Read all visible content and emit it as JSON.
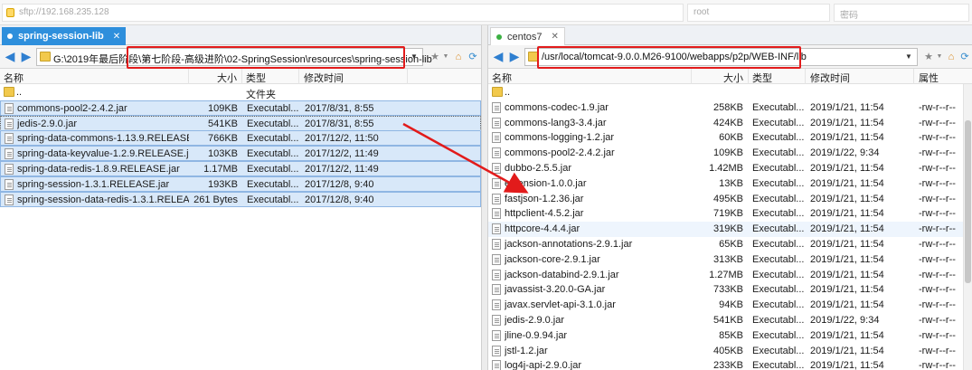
{
  "topbar": {
    "host_placeholder": "sftp://192.168.235.128",
    "user_placeholder": "root",
    "password_placeholder": "密码"
  },
  "left": {
    "tab_label": "spring-session-lib",
    "path": "G:\\2019年最后阶段\\第七阶段-高级进阶\\02-SpringSession\\resources\\spring-session-lib",
    "columns": {
      "name": "名称",
      "size": "大小",
      "type": "类型",
      "mtime": "修改时间"
    },
    "rows": [
      {
        "name": "..",
        "size": "",
        "type": "文件夹",
        "mtime": "",
        "kind": "dir",
        "state": ""
      },
      {
        "name": "commons-pool2-2.4.2.jar",
        "size": "109KB",
        "type": "Executabl...",
        "mtime": "2017/8/31, 8:55",
        "kind": "file",
        "state": "selected"
      },
      {
        "name": "jedis-2.9.0.jar",
        "size": "541KB",
        "type": "Executabl...",
        "mtime": "2017/8/31, 8:55",
        "kind": "file",
        "state": "focused"
      },
      {
        "name": "spring-data-commons-1.13.9.RELEASE.j...",
        "size": "766KB",
        "type": "Executabl...",
        "mtime": "2017/12/2, 11:50",
        "kind": "file",
        "state": "selected"
      },
      {
        "name": "spring-data-keyvalue-1.2.9.RELEASE.jar",
        "size": "103KB",
        "type": "Executabl...",
        "mtime": "2017/12/2, 11:49",
        "kind": "file",
        "state": "selected"
      },
      {
        "name": "spring-data-redis-1.8.9.RELEASE.jar",
        "size": "1.17MB",
        "type": "Executabl...",
        "mtime": "2017/12/2, 11:49",
        "kind": "file",
        "state": "selected"
      },
      {
        "name": "spring-session-1.3.1.RELEASE.jar",
        "size": "193KB",
        "type": "Executabl...",
        "mtime": "2017/12/8, 9:40",
        "kind": "file",
        "state": "selected"
      },
      {
        "name": "spring-session-data-redis-1.3.1.RELEAS...",
        "size": "261 Bytes",
        "type": "Executabl...",
        "mtime": "2017/12/8, 9:40",
        "kind": "file",
        "state": "selected"
      }
    ]
  },
  "right": {
    "tab_label": "centos7",
    "path": "/usr/local/tomcat-9.0.0.M26-9100/webapps/p2p/WEB-INF/lib",
    "columns": {
      "name": "名称",
      "size": "大小",
      "type": "类型",
      "mtime": "修改时间",
      "attr": "属性"
    },
    "rows": [
      {
        "name": "..",
        "size": "",
        "type": "",
        "mtime": "",
        "attr": "",
        "kind": "dir",
        "state": ""
      },
      {
        "name": "commons-codec-1.9.jar",
        "size": "258KB",
        "type": "Executabl...",
        "mtime": "2019/1/21, 11:54",
        "attr": "-rw-r--r--",
        "kind": "file",
        "state": ""
      },
      {
        "name": "commons-lang3-3.4.jar",
        "size": "424KB",
        "type": "Executabl...",
        "mtime": "2019/1/21, 11:54",
        "attr": "-rw-r--r--",
        "kind": "file",
        "state": ""
      },
      {
        "name": "commons-logging-1.2.jar",
        "size": "60KB",
        "type": "Executabl...",
        "mtime": "2019/1/21, 11:54",
        "attr": "-rw-r--r--",
        "kind": "file",
        "state": ""
      },
      {
        "name": "commons-pool2-2.4.2.jar",
        "size": "109KB",
        "type": "Executabl...",
        "mtime": "2019/1/22, 9:34",
        "attr": "-rw-r--r--",
        "kind": "file",
        "state": ""
      },
      {
        "name": "dubbo-2.5.5.jar",
        "size": "1.42MB",
        "type": "Executabl...",
        "mtime": "2019/1/21, 11:54",
        "attr": "-rw-r--r--",
        "kind": "file",
        "state": ""
      },
      {
        "name": "extension-1.0.0.jar",
        "size": "13KB",
        "type": "Executabl...",
        "mtime": "2019/1/21, 11:54",
        "attr": "-rw-r--r--",
        "kind": "file",
        "state": ""
      },
      {
        "name": "fastjson-1.2.36.jar",
        "size": "495KB",
        "type": "Executabl...",
        "mtime": "2019/1/21, 11:54",
        "attr": "-rw-r--r--",
        "kind": "file",
        "state": ""
      },
      {
        "name": "httpclient-4.5.2.jar",
        "size": "719KB",
        "type": "Executabl...",
        "mtime": "2019/1/21, 11:54",
        "attr": "-rw-r--r--",
        "kind": "file",
        "state": ""
      },
      {
        "name": "httpcore-4.4.4.jar",
        "size": "319KB",
        "type": "Executabl...",
        "mtime": "2019/1/21, 11:54",
        "attr": "-rw-r--r--",
        "kind": "file",
        "state": "hover"
      },
      {
        "name": "jackson-annotations-2.9.1.jar",
        "size": "65KB",
        "type": "Executabl...",
        "mtime": "2019/1/21, 11:54",
        "attr": "-rw-r--r--",
        "kind": "file",
        "state": ""
      },
      {
        "name": "jackson-core-2.9.1.jar",
        "size": "313KB",
        "type": "Executabl...",
        "mtime": "2019/1/21, 11:54",
        "attr": "-rw-r--r--",
        "kind": "file",
        "state": ""
      },
      {
        "name": "jackson-databind-2.9.1.jar",
        "size": "1.27MB",
        "type": "Executabl...",
        "mtime": "2019/1/21, 11:54",
        "attr": "-rw-r--r--",
        "kind": "file",
        "state": ""
      },
      {
        "name": "javassist-3.20.0-GA.jar",
        "size": "733KB",
        "type": "Executabl...",
        "mtime": "2019/1/21, 11:54",
        "attr": "-rw-r--r--",
        "kind": "file",
        "state": ""
      },
      {
        "name": "javax.servlet-api-3.1.0.jar",
        "size": "94KB",
        "type": "Executabl...",
        "mtime": "2019/1/21, 11:54",
        "attr": "-rw-r--r--",
        "kind": "file",
        "state": ""
      },
      {
        "name": "jedis-2.9.0.jar",
        "size": "541KB",
        "type": "Executabl...",
        "mtime": "2019/1/22, 9:34",
        "attr": "-rw-r--r--",
        "kind": "file",
        "state": ""
      },
      {
        "name": "jline-0.9.94.jar",
        "size": "85KB",
        "type": "Executabl...",
        "mtime": "2019/1/21, 11:54",
        "attr": "-rw-r--r--",
        "kind": "file",
        "state": ""
      },
      {
        "name": "jstl-1.2.jar",
        "size": "405KB",
        "type": "Executabl...",
        "mtime": "2019/1/21, 11:54",
        "attr": "-rw-r--r--",
        "kind": "file",
        "state": ""
      },
      {
        "name": "log4j-api-2.9.0.jar",
        "size": "233KB",
        "type": "Executabl...",
        "mtime": "2019/1/21, 11:54",
        "attr": "-rw-r--r--",
        "kind": "file",
        "state": ""
      }
    ]
  },
  "colors": {
    "accent": "#2e8fdc",
    "annotation": "#e21b1b",
    "selection": "#d8e8f9",
    "tab_status": "#3cb043"
  },
  "icons": [
    "lock-icon",
    "back-arrow-icon",
    "forward-arrow-icon",
    "folder-icon",
    "star-icon",
    "home-icon",
    "refresh-icon",
    "file-icon",
    "close-icon"
  ]
}
